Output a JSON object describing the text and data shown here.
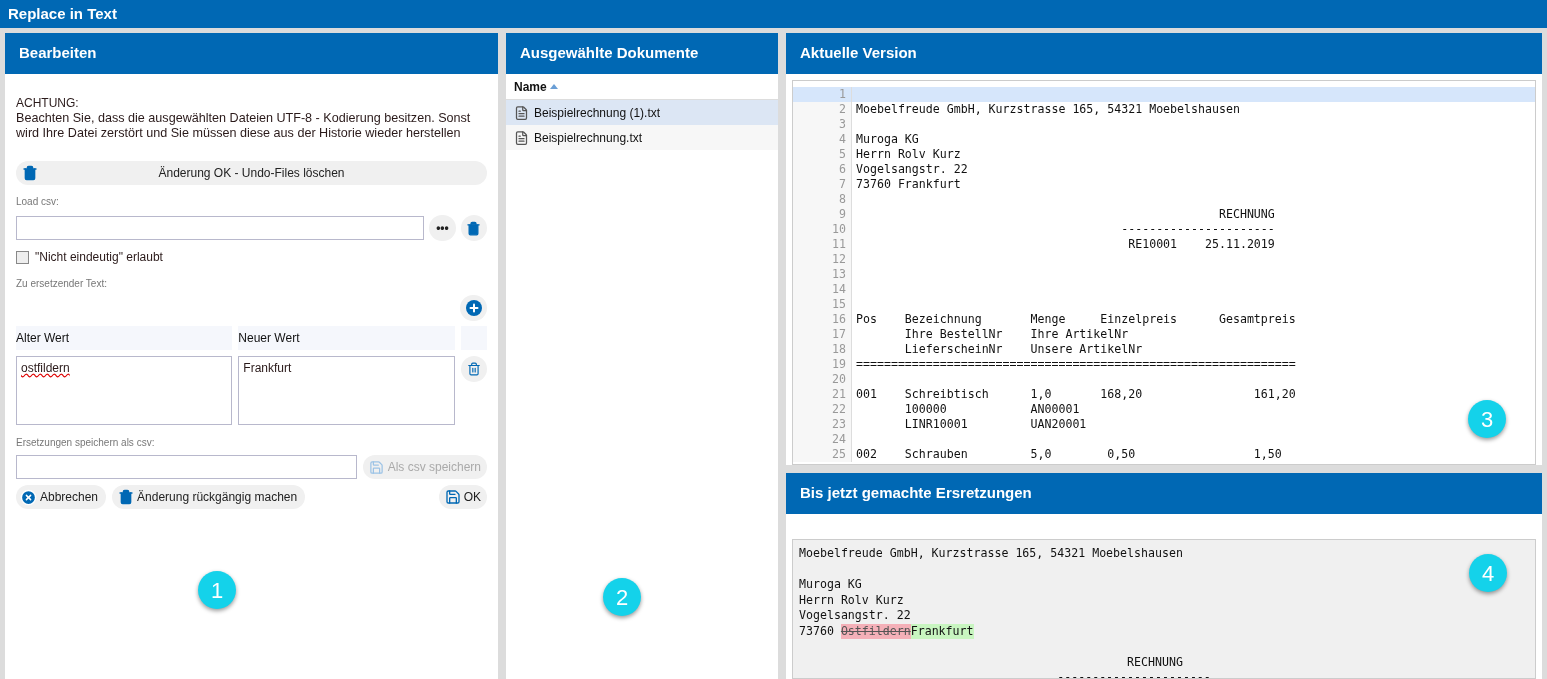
{
  "window": {
    "title": "Replace in Text"
  },
  "edit_panel": {
    "title": "Bearbeiten",
    "warning_title": "ACHTUNG:",
    "warning_text": "Beachten Sie, dass die ausgewählten Dateien UTF-8 - Kodierung besitzen. Sonst wird Ihre Datei zerstört und Sie müssen diese aus der Historie wieder herstellen",
    "confirm_button": "Änderung OK - Undo-Files löschen",
    "load_csv_label": "Load csv:",
    "browse_button": "•••",
    "not_unique": {
      "label": "\"Nicht eindeutig\" erlaubt",
      "checked": false
    },
    "replace_label": "Zu ersetzender Text:",
    "columns": [
      "Alter Wert",
      "Neuer Wert"
    ],
    "rows": [
      {
        "old": "ostfildern",
        "new": "Frankfurt"
      }
    ],
    "save_label": "Ersetzungen speichern als csv:",
    "save_button": {
      "label": "Als csv speichern",
      "disabled": true
    },
    "cancel_button": "Abbrechen",
    "undo_button": "Änderung rückgängig machen",
    "ok_button": "OK"
  },
  "documents_panel": {
    "title": "Ausgewählte Dokumente",
    "column": "Name",
    "files": [
      {
        "name": "Beispielrechnung (1).txt",
        "selected": true
      },
      {
        "name": "Beispielrechnung.txt",
        "selected": false
      }
    ]
  },
  "version_panel": {
    "title": "Aktuelle Version",
    "lines": [
      {
        "n": "1",
        "highlighted": true
      },
      {
        "n": "2",
        "text": "Moebelfreude GmbH, Kurzstrasse 165, 54321 Moebelshausen",
        "highlighted": false
      },
      {
        "n": "3",
        "highlighted": false
      },
      {
        "n": "4",
        "text": "Muroga KG",
        "highlighted": false
      },
      {
        "n": "5",
        "text": "Herrn Rolv Kurz",
        "highlighted": false
      },
      {
        "n": "6",
        "text": "Vogelsangstr. 22",
        "highlighted": false
      },
      {
        "n": "7",
        "text": "73760 Frankfurt",
        "highlighted": false
      },
      {
        "n": "8",
        "highlighted": false
      },
      {
        "n": "9",
        "text": "                                                    RECHNUNG",
        "highlighted": false
      },
      {
        "n": "10",
        "text": "                                      ----------------------",
        "highlighted": false
      },
      {
        "n": "11",
        "text": "                                       RE10001    25.11.2019",
        "highlighted": false
      },
      {
        "n": "12",
        "highlighted": false
      },
      {
        "n": "13",
        "highlighted": false
      },
      {
        "n": "14",
        "highlighted": false
      },
      {
        "n": "15",
        "highlighted": false
      },
      {
        "n": "16",
        "text": "Pos    Bezeichnung       Menge     Einzelpreis      Gesamtpreis",
        "highlighted": false
      },
      {
        "n": "17",
        "text": "       Ihre BestellNr    Ihre ArtikelNr",
        "highlighted": false
      },
      {
        "n": "18",
        "text": "       LieferscheinNr    Unsere ArtikelNr",
        "highlighted": false
      },
      {
        "n": "19",
        "text": "===============================================================",
        "highlighted": false
      },
      {
        "n": "20",
        "highlighted": false
      },
      {
        "n": "21",
        "text": "001    Schreibtisch      1,0       168,20                161,20",
        "highlighted": false
      },
      {
        "n": "22",
        "text": "       100000            AN00001",
        "highlighted": false
      },
      {
        "n": "23",
        "text": "       LINR10001         UAN20001",
        "highlighted": false
      },
      {
        "n": "24",
        "highlighted": false
      },
      {
        "n": "25",
        "text": "002    Schrauben         5,0        0,50                 1,50",
        "highlighted": false
      }
    ]
  },
  "changes_panel": {
    "title": "Bis jetzt gemachte Ersretzungen",
    "lines": [
      {
        "space_before": false,
        "segments": [
          {
            "kind": "plain",
            "text": "Moebelfreude GmbH, Kurzstrasse 165, 54321 Moebelshausen"
          }
        ]
      },
      {
        "space_before": true,
        "segments": [
          {
            "kind": "plain",
            "text": "Muroga KG"
          }
        ]
      },
      {
        "space_before": false,
        "segments": [
          {
            "kind": "plain",
            "text": "Herrn Rolv Kurz"
          }
        ]
      },
      {
        "space_before": false,
        "segments": [
          {
            "kind": "plain",
            "text": "Vogelsangstr. 22"
          }
        ]
      },
      {
        "space_before": false,
        "segments": [
          {
            "kind": "plain",
            "text": "73760 "
          },
          {
            "kind": "removed",
            "text": "Ostfildern"
          },
          {
            "kind": "added",
            "text": "Frankfurt"
          }
        ]
      },
      {
        "space_before": true,
        "segments": [
          {
            "kind": "plain",
            "text": "                                               RECHNUNG"
          }
        ]
      },
      {
        "space_before": false,
        "segments": [
          {
            "kind": "plain",
            "text": "                                     ----------------------"
          }
        ]
      }
    ]
  },
  "markers": [
    "1",
    "2",
    "3",
    "4"
  ]
}
